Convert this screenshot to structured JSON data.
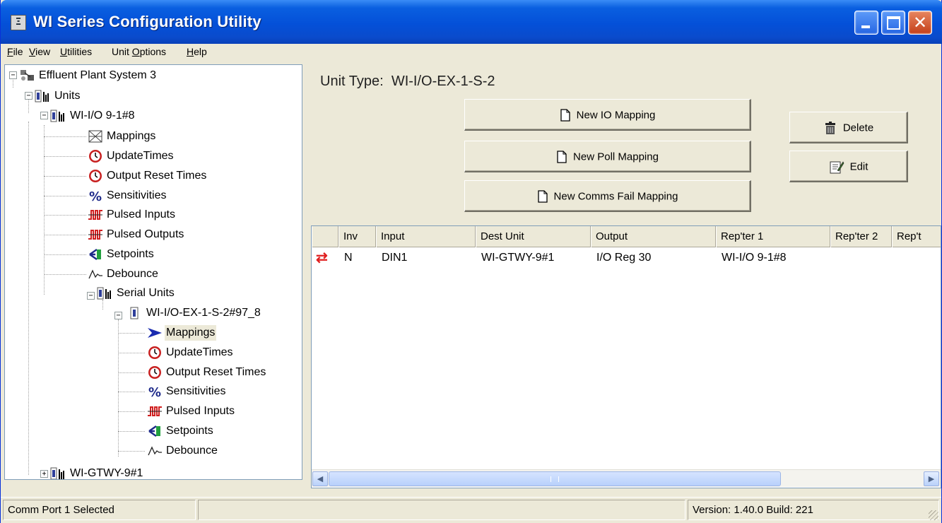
{
  "window": {
    "title": "WI Series Configuration Utility",
    "icon_glyph": "Ξ"
  },
  "menu": [
    {
      "pre": "",
      "ul": "F",
      "post": "ile"
    },
    {
      "pre": "",
      "ul": "V",
      "post": "iew"
    },
    {
      "pre": "",
      "ul": "U",
      "post": "tilities"
    },
    {
      "pre": "Unit ",
      "ul": "O",
      "post": "ptions"
    },
    {
      "pre": "",
      "ul": "H",
      "post": "elp"
    }
  ],
  "tree": {
    "root": "Effluent Plant System 3",
    "units": "Units",
    "unit1": "WI-I/O 9-1#8",
    "unit1_children": [
      "Mappings",
      "UpdateTimes",
      "Output Reset Times",
      "Sensitivities",
      "Pulsed Inputs",
      "Pulsed Outputs",
      "Setpoints",
      "Debounce"
    ],
    "serial_units": "Serial Units",
    "serial_unit": "WI-I/O-EX-1-S-2#97_8",
    "serial_children": [
      "Mappings",
      "UpdateTimes",
      "Output Reset Times",
      "Sensitivities",
      "Pulsed Inputs",
      "Setpoints",
      "Debounce"
    ],
    "gateway": "WI-GTWY-9#1"
  },
  "main": {
    "unit_type_label": "Unit Type:",
    "unit_type_value": "WI-I/O-EX-1-S-2",
    "buttons": {
      "new_io": "New IO Mapping",
      "new_poll": "New Poll Mapping",
      "new_comms_fail": "New Comms Fail Mapping",
      "delete": "Delete",
      "edit": "Edit"
    },
    "columns": [
      "",
      "Inv",
      "Input",
      "Dest Unit",
      "Output",
      "Rep'ter 1",
      "Rep'ter 2",
      "Rep't"
    ],
    "rows": [
      {
        "icon": "⇄",
        "inv": "N",
        "input": "DIN1",
        "dest": "WI-GTWY-9#1",
        "output": "I/O Reg 30",
        "rep1": "WI-I/O 9-1#8",
        "rep2": ""
      }
    ]
  },
  "status": {
    "left": "Comm Port 1 Selected",
    "middle": "",
    "version": "Version: 1.40.0 Build: 221"
  },
  "colors": {
    "titlebar": "#0450d8",
    "selection": "#ece9d8",
    "row_icon": "#e02020"
  }
}
